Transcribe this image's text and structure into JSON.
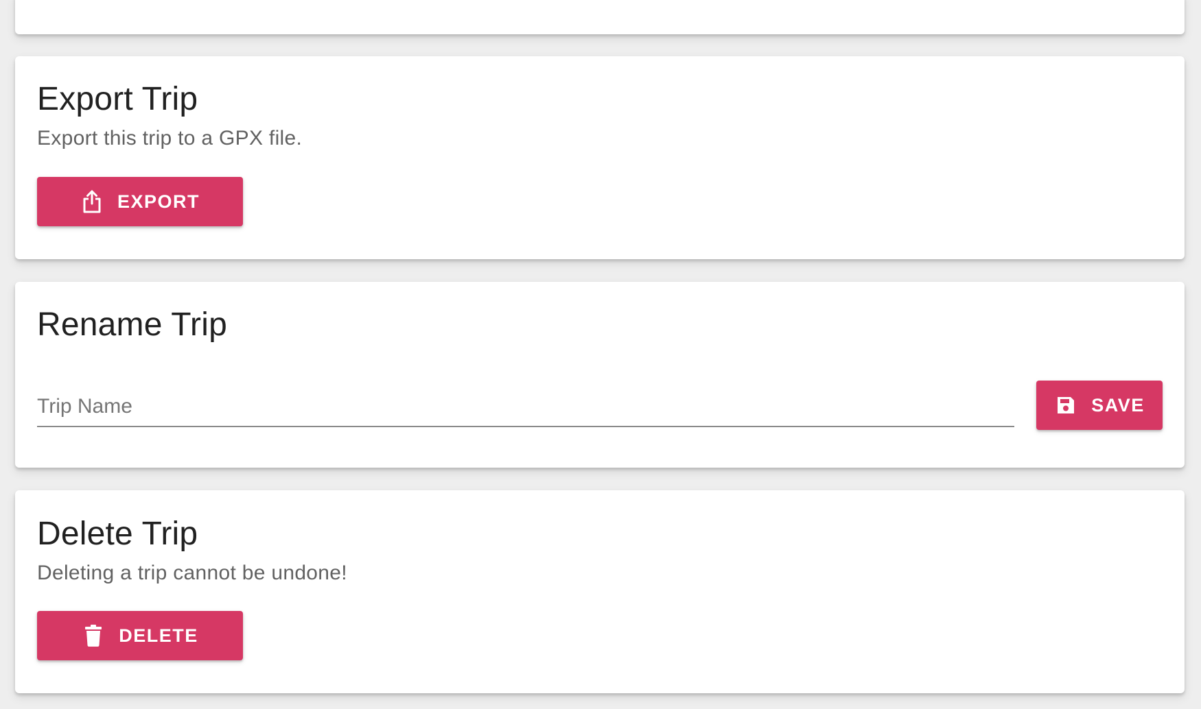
{
  "export_card": {
    "title": "Export Trip",
    "subtitle": "Export this trip to a GPX file.",
    "button_label": "EXPORT",
    "button_icon": "export-share-icon"
  },
  "rename_card": {
    "title": "Rename Trip",
    "input_placeholder": "Trip Name",
    "input_value": "",
    "button_label": "SAVE",
    "button_icon": "save-floppy-icon"
  },
  "delete_card": {
    "title": "Delete Trip",
    "subtitle": "Deleting a trip cannot be undone!",
    "button_label": "DELETE",
    "button_icon": "trash-icon"
  },
  "colors": {
    "accent": "#d63864",
    "background": "#eeeeee",
    "card": "#ffffff",
    "title_text": "#212121",
    "secondary_text": "#616161"
  }
}
